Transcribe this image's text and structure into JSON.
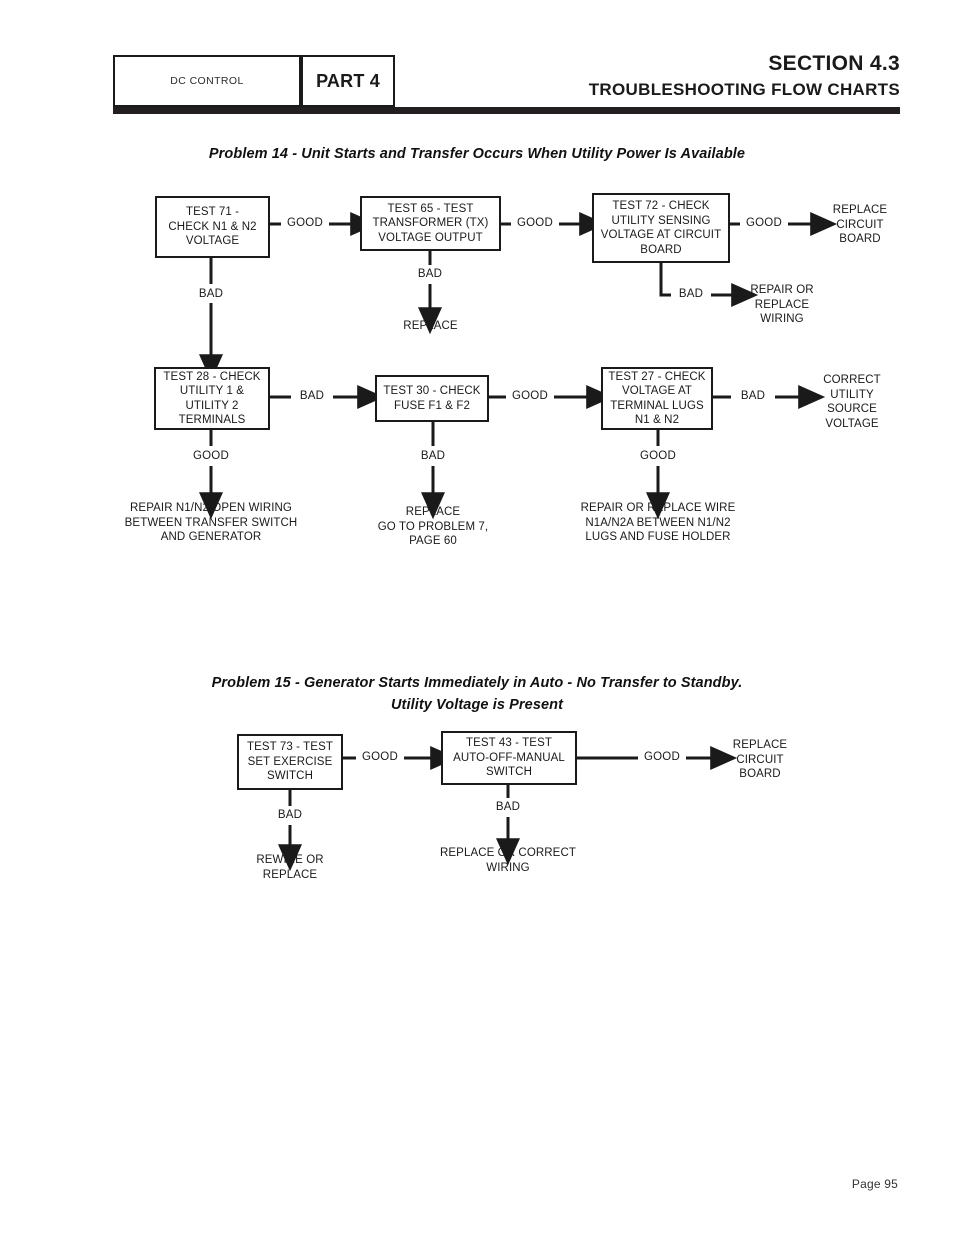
{
  "header": {
    "dc_control": "DC CONTROL",
    "part": "PART 4",
    "section": "SECTION 4.3",
    "subtitle": "TROUBLESHOOTING FLOW CHARTS"
  },
  "problem14": {
    "title": "Problem 14 - Unit Starts and Transfer Occurs When Utility Power Is Available",
    "nodes": {
      "test71": "TEST 71 -\nCHECK N1 & N2\nVOLTAGE",
      "test65": "TEST 65 - TEST\nTRANSFORMER (TX)\nVOLTAGE OUTPUT",
      "test72": "TEST 72 - CHECK\nUTILITY SENSING\nVOLTAGE AT CIRCUIT\nBOARD",
      "test28": "TEST 28 - CHECK\nUTILITY 1 &\nUTILITY 2\nTERMINALS",
      "test30": "TEST 30 - CHECK\nFUSE F1 & F2",
      "test27": "TEST 27 - CHECK\nVOLTAGE AT\nTERMINAL LUGS\nN1 & N2"
    },
    "edges": {
      "e71_65": "GOOD",
      "e65_72": "GOOD",
      "e72_replaceboard": "GOOD",
      "e71_28": "BAD",
      "e65_replace": "BAD",
      "e72_repairwiring": "BAD",
      "e28_30": "BAD",
      "e30_27": "GOOD",
      "e27_correct": "BAD",
      "e28_repair": "GOOD",
      "e30_replace": "BAD",
      "e27_repair": "GOOD"
    },
    "terminals": {
      "replace_circuit_board": "REPLACE\nCIRCUIT\nBOARD",
      "replace": "REPLACE",
      "repair_or_replace_wiring": "REPAIR OR\nREPLACE\nWIRING",
      "correct_utility_source_voltage": "CORRECT\nUTILITY\nSOURCE\nVOLTAGE",
      "repair_open_wiring": "REPAIR N1/N2 OPEN WIRING\nBETWEEN TRANSFER SWITCH\nAND GENERATOR",
      "replace_goto_problem7": "REPLACE\nGO TO PROBLEM 7,\nPAGE  60",
      "repair_replace_wire": "REPAIR OR REPLACE WIRE\nN1A/N2A BETWEEN N1/N2\nLUGS AND FUSE HOLDER"
    }
  },
  "problem15": {
    "title_line1": "Problem 15 - Generator Starts Immediately in Auto - No Transfer to Standby.",
    "title_line2": "Utility Voltage is Present",
    "nodes": {
      "test73": "TEST 73 - TEST\nSET EXERCISE\nSWITCH",
      "test43": "TEST 43 - TEST\nAUTO-OFF-MANUAL\nSWITCH"
    },
    "edges": {
      "e73_43": "GOOD",
      "e43_replaceboard": "GOOD",
      "e73_rewire": "BAD",
      "e43_replacewiring": "BAD"
    },
    "terminals": {
      "replace_circuit_board": "REPLACE\nCIRCUIT\nBOARD",
      "rewire_or_replace": "REWIRE OR\nREPLACE",
      "replace_or_correct_wiring": "REPLACE OR CORRECT\nWIRING"
    }
  },
  "footer": {
    "page": "Page 95"
  },
  "colors": {
    "ink": "#1a1a1a",
    "rule": "#231f20",
    "paper": "#ffffff"
  }
}
